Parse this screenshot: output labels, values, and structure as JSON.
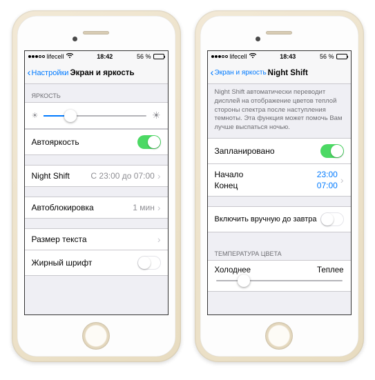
{
  "left": {
    "status": {
      "carrier": "lifecell",
      "time": "18:42",
      "battery_pct": "56 %"
    },
    "nav": {
      "back": "Настройки",
      "title": "Экран и яркость"
    },
    "brightness_header": "ЯРКОСТЬ",
    "brightness_pct": 26,
    "auto_brightness": "Автояркость",
    "night_shift": {
      "label": "Night Shift",
      "detail": "С 23:00 до 07:00"
    },
    "autolock": {
      "label": "Автоблокировка",
      "detail": "1 мин"
    },
    "text_size": "Размер текста",
    "bold_text": "Жирный шрифт"
  },
  "right": {
    "status": {
      "carrier": "lifecell",
      "time": "18:43",
      "battery_pct": "56 %"
    },
    "nav": {
      "back": "Экран и яркость",
      "title": "Night Shift"
    },
    "desc": "Night Shift автоматически переводит дисплей на отображение цветов теплой стороны спектра после наступления темноты. Эта функция может помочь Вам лучше выспаться ночью.",
    "scheduled": "Запланировано",
    "start_label": "Начало",
    "end_label": "Конец",
    "start_time": "23:00",
    "end_time": "07:00",
    "manual": "Включить вручную до завтра",
    "temp_header": "ТЕМПЕРАТУРА ЦВЕТА",
    "temp_cold": "Холоднее",
    "temp_warm": "Теплее",
    "temp_pct": 22
  }
}
